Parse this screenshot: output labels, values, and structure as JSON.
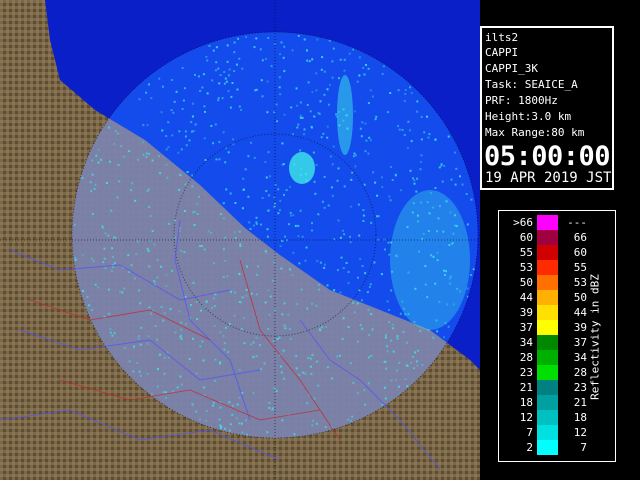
{
  "info": {
    "lines": [
      "ilts2",
      "CAPPI",
      "CAPPI_3K",
      "Task: SEAICE_A",
      "PRF: 1800Hz",
      "Height:3.0 km",
      "Max Range:80 km"
    ],
    "time": "05:00:00",
    "date": "19 APR 2019 JST"
  },
  "legend": {
    "title": "Reflectivity in dBZ",
    "rows": [
      {
        "low": ">66",
        "high": "---",
        "color": "#ff00ff"
      },
      {
        "low": "60",
        "high": "66",
        "color": "#a00040"
      },
      {
        "low": "55",
        "high": "60",
        "color": "#d00000"
      },
      {
        "low": "53",
        "high": "55",
        "color": "#ff2a00"
      },
      {
        "low": "50",
        "high": "53",
        "color": "#ff7000"
      },
      {
        "low": "44",
        "high": "50",
        "color": "#ffb000"
      },
      {
        "low": "39",
        "high": "44",
        "color": "#ffe000"
      },
      {
        "low": "37",
        "high": "39",
        "color": "#ffff00"
      },
      {
        "low": "34",
        "high": "37",
        "color": "#008800"
      },
      {
        "low": "28",
        "high": "34",
        "color": "#00b000"
      },
      {
        "low": "23",
        "high": "28",
        "color": "#00e000"
      },
      {
        "low": "21",
        "high": "23",
        "color": "#008080"
      },
      {
        "low": "18",
        "high": "21",
        "color": "#00a0a0"
      },
      {
        "low": "12",
        "high": "18",
        "color": "#00c0c0"
      },
      {
        "low": "7",
        "high": "12",
        "color": "#00e0e0"
      },
      {
        "low": "2",
        "high": "7",
        "color": "#00ffff"
      }
    ]
  },
  "map": {
    "sea_color": "#0a2fe0",
    "land_color": "#7a6848",
    "echo_color": "#3ee8e8"
  }
}
